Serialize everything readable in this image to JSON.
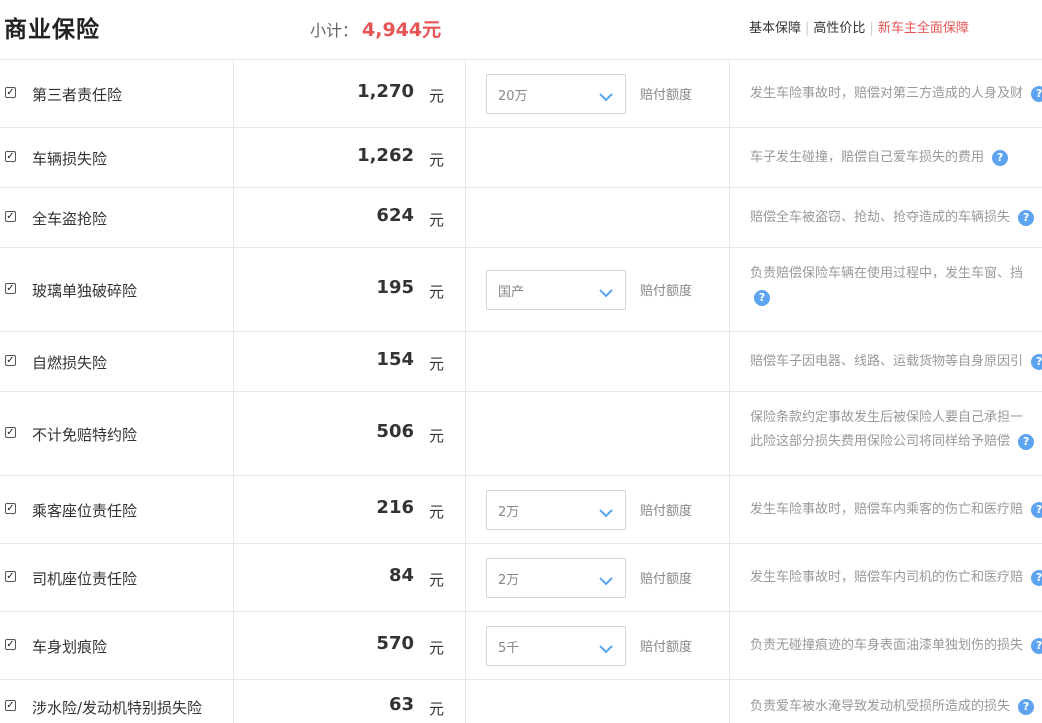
{
  "header": {
    "title": "商业保险",
    "subtotal_label": "小计：",
    "subtotal_value": "4,944元",
    "tabs": [
      "基本保障",
      "高性价比",
      "新车主全面保障"
    ]
  },
  "colors": {
    "accent_red": "#e55555",
    "help_icon_blue": "#5ea3ef"
  },
  "unit_label": "元",
  "amount_label": "赔付额度",
  "items": [
    {
      "name": "第三者责任险",
      "price": "1,270",
      "select": "20万",
      "desc1": "发生车险事故时，赔偿对第三方造成的人身及财",
      "desc2": ""
    },
    {
      "name": "车辆损失险",
      "price": "1,262",
      "select": "",
      "desc1": "车子发生碰撞，赔偿自己爱车损失的费用",
      "desc2": ""
    },
    {
      "name": "全车盗抢险",
      "price": "624",
      "select": "",
      "desc1": "赔偿全车被盗窃、抢劫、抢夺造成的车辆损失",
      "desc2": ""
    },
    {
      "name": "玻璃单独破碎险",
      "price": "195",
      "select": "国产",
      "desc1": "负责赔偿保险车辆在使用过程中，发生车窗、挡",
      "desc2": ""
    },
    {
      "name": "自燃损失险",
      "price": "154",
      "select": "",
      "desc1": "赔偿车子因电器、线路、运载货物等自身原因引",
      "desc2": ""
    },
    {
      "name": "不计免赔特约险",
      "price": "506",
      "select": "",
      "desc1": "保险条款约定事故发生后被保险人要自己承担一",
      "desc2": "此险这部分损失费用保险公司将同样给予赔偿"
    },
    {
      "name": "乘客座位责任险",
      "price": "216",
      "select": "2万",
      "desc1": "发生车险事故时，赔偿车内乘客的伤亡和医疗赔",
      "desc2": ""
    },
    {
      "name": "司机座位责任险",
      "price": "84",
      "select": "2万",
      "desc1": "发生车险事故时，赔偿车内司机的伤亡和医疗赔",
      "desc2": ""
    },
    {
      "name": "车身划痕险",
      "price": "570",
      "select": "5千",
      "desc1": "负责无碰撞痕迹的车身表面油漆单独划伤的损失",
      "desc2": ""
    },
    {
      "name": "涉水险/发动机特别损失险",
      "price": "63",
      "select": "",
      "desc1": "负责爱车被水淹导致发动机受损所造成的损失",
      "desc2": ""
    }
  ]
}
